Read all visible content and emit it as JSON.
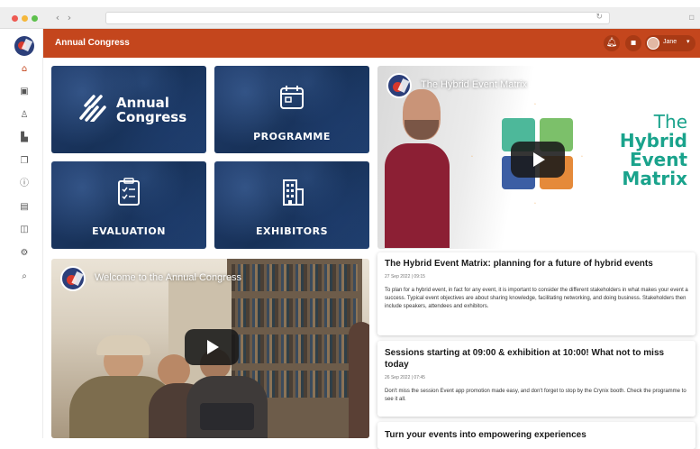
{
  "app": {
    "title": "Annual Congress",
    "accent_color": "#c4461d",
    "tile_color": "#1f3a68",
    "user": {
      "name": "Jane"
    }
  },
  "browser": {
    "controls": [
      "back-icon",
      "forward-icon",
      "reload-icon"
    ]
  },
  "sidebar": {
    "items": [
      {
        "icon": "home-icon",
        "active": true
      },
      {
        "icon": "calendar-icon",
        "active": false
      },
      {
        "icon": "person-icon",
        "active": false
      },
      {
        "icon": "buildings-icon",
        "active": false
      },
      {
        "icon": "documents-icon",
        "active": false
      },
      {
        "icon": "info-icon",
        "active": false
      },
      {
        "icon": "schedule-icon",
        "active": false
      },
      {
        "icon": "map-icon",
        "active": false
      },
      {
        "icon": "settings-icon",
        "active": false
      },
      {
        "icon": "search-icon",
        "active": false
      }
    ]
  },
  "tiles": {
    "congress": {
      "line1": "Annual",
      "line2": "Congress"
    },
    "programme": {
      "label": "PROGRAMME",
      "icon": "calendar-icon"
    },
    "evaluation": {
      "label": "EVALUATION",
      "icon": "checklist-icon"
    },
    "exhibitors": {
      "label": "EXHIBITORS",
      "icon": "building-icon"
    }
  },
  "videos": {
    "hybrid": {
      "title": "The Hybrid Event Matrix",
      "overlay": {
        "line1": "The",
        "line2": "Hybrid",
        "line3": "Event",
        "line4": "Matrix"
      }
    },
    "welcome": {
      "title": "Welcome to the Annual Congress"
    }
  },
  "articles": [
    {
      "title": "The Hybrid Event Matrix: planning for a future of hybrid events",
      "date": "27 Sep 2022 | 09:15",
      "body": "To plan for a hybrid event, in fact for any event, it is important to consider the different stakeholders in what makes your event a success. Typical event objectives are about sharing knowledge, facilitating networking, and doing business. Stakeholders then include speakers, attendees and exhibitors."
    },
    {
      "title": "Sessions starting at 09:00 & exhibition at 10:00! What not to miss today",
      "date": "26 Sep 2022 | 07:45",
      "body": "Don't miss the session Event app promotion made easy, and don't forget to stop by the Crynix booth. Check the programme to see it all."
    },
    {
      "title": "Turn your events into empowering experiences"
    }
  ]
}
